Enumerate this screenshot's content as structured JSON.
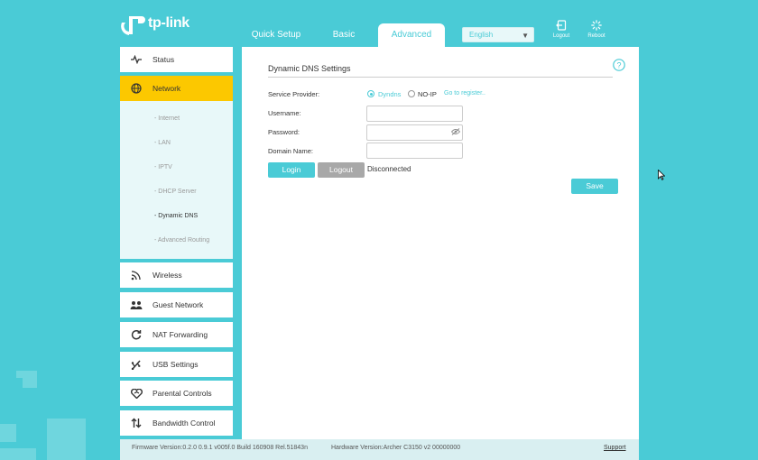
{
  "brand": {
    "logo_text": "tp-link"
  },
  "nav": {
    "tabs": [
      {
        "label": "Quick Setup"
      },
      {
        "label": "Basic"
      },
      {
        "label": "Advanced"
      }
    ],
    "language": "English",
    "logout_label": "Logout",
    "reboot_label": "Reboot"
  },
  "sidebar": {
    "items": [
      {
        "label": "Status",
        "icon": "pulse-icon"
      },
      {
        "label": "Network",
        "icon": "globe-icon"
      },
      {
        "label": "Wireless",
        "icon": "wifi-icon"
      },
      {
        "label": "Guest Network",
        "icon": "users-icon"
      },
      {
        "label": "NAT Forwarding",
        "icon": "refresh-icon"
      },
      {
        "label": "USB Settings",
        "icon": "usb-icon"
      },
      {
        "label": "Parental Controls",
        "icon": "heart-icon"
      },
      {
        "label": "Bandwidth Control",
        "icon": "arrows-icon"
      }
    ],
    "submenu": [
      {
        "label": "- Internet"
      },
      {
        "label": "- LAN"
      },
      {
        "label": "- IPTV"
      },
      {
        "label": "- DHCP Server"
      },
      {
        "label": "- Dynamic DNS"
      },
      {
        "label": "- Advanced Routing"
      }
    ]
  },
  "ddns": {
    "title": "Dynamic DNS Settings",
    "service_provider_label": "Service Provider:",
    "providers": [
      {
        "label": "Dyndns",
        "selected": true
      },
      {
        "label": "NO-IP",
        "selected": false
      }
    ],
    "register_link": "Go to register..",
    "username_label": "Username:",
    "password_label": "Password:",
    "domain_label": "Domain Name:",
    "username_value": "",
    "password_value": "",
    "domain_value": "",
    "login_label": "Login",
    "logout_label": "Logout",
    "status_text": "Disconnected",
    "save_label": "Save"
  },
  "footer": {
    "firmware": "Firmware Version:0.2.0 0.9.1 v005f.0 Build 160908 Rel.51843n",
    "hardware": "Hardware Version:Archer C3150 v2 00000000",
    "support": "Support"
  },
  "colors": {
    "accent": "#4acbd6",
    "active_menu": "#fcc800",
    "logout_button": "#a8a8a8"
  }
}
